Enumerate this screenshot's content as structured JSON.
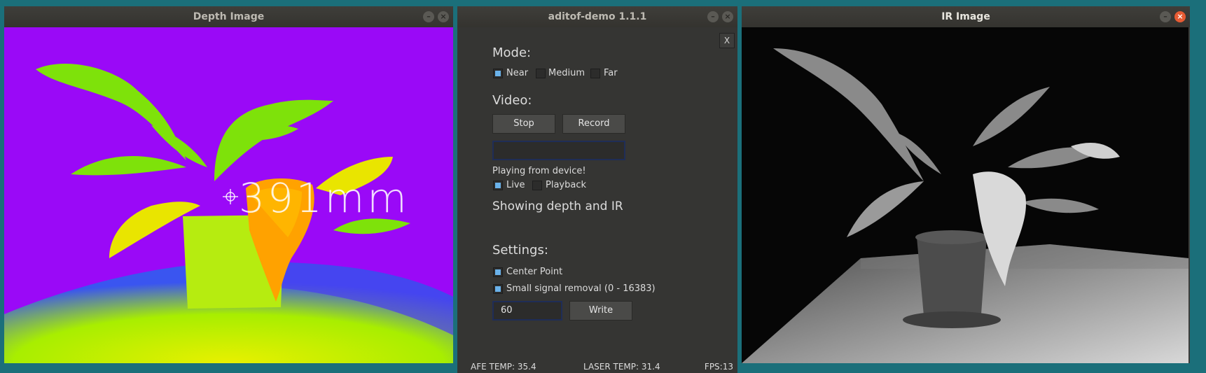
{
  "depth_window": {
    "title": "Depth Image",
    "readout": "391mm"
  },
  "demo_window": {
    "title": "aditof-demo 1.1.1",
    "close_label": "X",
    "mode": {
      "heading": "Mode:",
      "options": [
        {
          "label": "Near",
          "checked": true
        },
        {
          "label": "Medium",
          "checked": false
        },
        {
          "label": "Far",
          "checked": false
        }
      ]
    },
    "video": {
      "heading": "Video:",
      "stop_label": "Stop",
      "record_label": "Record",
      "filename_value": "",
      "playing_status": "Playing from device!",
      "live_label": "Live",
      "playback_label": "Playback",
      "showing_status": "Showing depth and IR"
    },
    "settings": {
      "heading": "Settings:",
      "center_point_label": "Center Point",
      "small_signal_label": "Small signal removal (0 - 16383)",
      "threshold_value": "60",
      "write_label": "Write"
    },
    "status_bar": {
      "afe_temp": "AFE TEMP: 35.4",
      "laser_temp": "LASER TEMP: 31.4",
      "fps": "FPS:13"
    }
  },
  "ir_window": {
    "title": "IR Image"
  },
  "colors": {
    "desktop": "#1b6f7a",
    "depth_background": "#9a09f7",
    "checkbox_accent": "#6ab2ea",
    "titlebar_close_red": "#e65b33"
  },
  "icons": [
    "minimize-icon",
    "close-icon",
    "crosshair-icon"
  ]
}
